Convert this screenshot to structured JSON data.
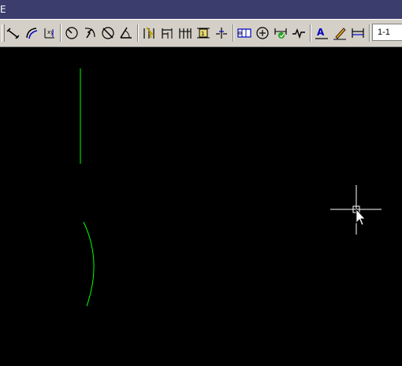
{
  "window": {
    "title_fragment": "E"
  },
  "toolbar": {
    "buttons": [
      {
        "icon": "dim-linear-icon"
      },
      {
        "icon": "dim-arc-length-icon"
      },
      {
        "icon": "dim-ordinate-icon"
      },
      {
        "icon": "dim-radius-icon"
      },
      {
        "icon": "dim-jogged-icon"
      },
      {
        "icon": "dim-diameter-icon"
      },
      {
        "icon": "dim-angular-icon"
      },
      {
        "icon": "quick-dimension-icon"
      },
      {
        "icon": "dim-baseline-icon"
      },
      {
        "icon": "dim-continue-icon"
      },
      {
        "icon": "dim-space-icon"
      },
      {
        "icon": "dim-break-icon"
      },
      {
        "icon": "tolerance-icon"
      },
      {
        "icon": "center-mark-icon"
      },
      {
        "icon": "inspection-icon"
      },
      {
        "icon": "jogged-linear-icon"
      },
      {
        "icon": "dim-edit-icon"
      },
      {
        "icon": "dim-text-edit-icon"
      },
      {
        "icon": "dim-update-icon"
      }
    ],
    "dim_style_value": "1-1"
  },
  "colors": {
    "geometry": "#00ff00",
    "crosshair": "#ffffff",
    "background": "#000000",
    "title_bar": "#3b3d6d",
    "toolbar": "#d4d0c8"
  }
}
